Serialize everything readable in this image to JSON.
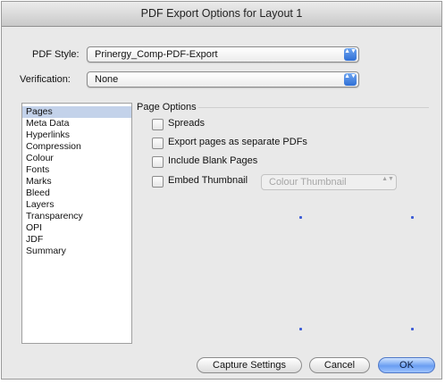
{
  "window": {
    "title": "PDF Export Options for Layout 1"
  },
  "pdf_style": {
    "label": "PDF Style:",
    "value": "Prinergy_Comp-PDF-Export",
    "arrows": "▲▼"
  },
  "verification": {
    "label": "Verification:",
    "value": "None",
    "arrows": "▲▼"
  },
  "sidebar": {
    "items": [
      {
        "label": "Pages",
        "selected": true
      },
      {
        "label": "Meta Data"
      },
      {
        "label": "Hyperlinks"
      },
      {
        "label": "Compression"
      },
      {
        "label": "Colour"
      },
      {
        "label": "Fonts"
      },
      {
        "label": "Marks"
      },
      {
        "label": "Bleed"
      },
      {
        "label": "Layers"
      },
      {
        "label": "Transparency"
      },
      {
        "label": "OPI"
      },
      {
        "label": "JDF"
      },
      {
        "label": "Summary"
      }
    ]
  },
  "page_options": {
    "title": "Page Options",
    "spreads": {
      "label": "Spreads",
      "checked": false
    },
    "separate_pdfs": {
      "label": "Export pages as separate PDFs",
      "checked": false
    },
    "blank_pages": {
      "label": "Include Blank Pages",
      "checked": false
    },
    "embed_thumbnail": {
      "label": "Embed Thumbnail",
      "checked": false
    },
    "thumbnail_popup": {
      "value": "Colour Thumbnail",
      "arrows": "▲▼",
      "enabled": false
    }
  },
  "buttons": {
    "capture_settings": "Capture Settings",
    "cancel": "Cancel",
    "ok": "OK"
  },
  "colors": {
    "selection": "#c3d2ea",
    "accent_blue": "#3b7be0",
    "dialog_bg": "#e9e9e9"
  }
}
